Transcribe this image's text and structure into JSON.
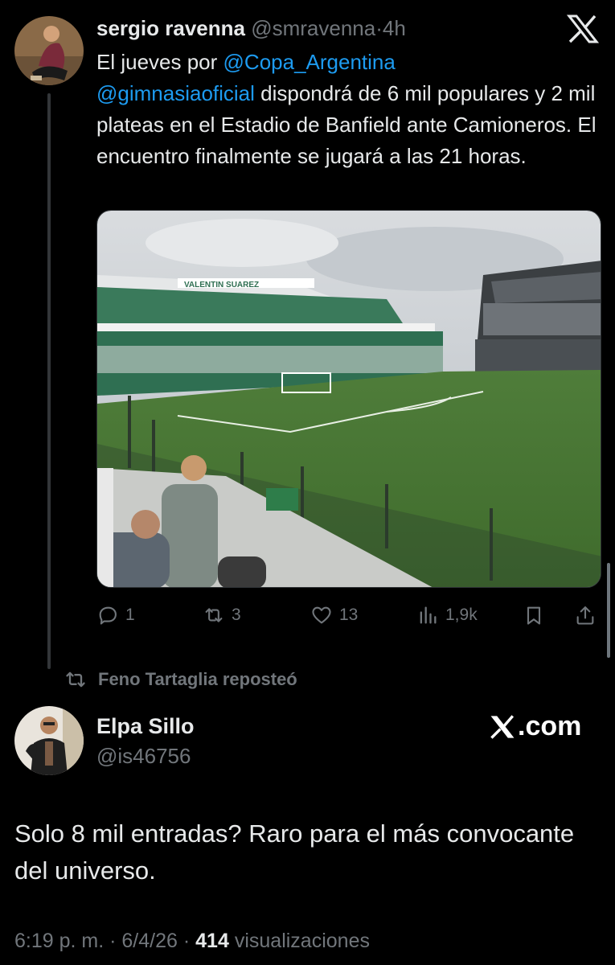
{
  "tweet": {
    "author_name": "sergio ravenna",
    "author_handle": "@smravenna",
    "separator": "·",
    "time": "4h",
    "text_part1": "El jueves por ",
    "mention1": "@Copa_Argentina",
    "mention2": "@gimnasiaoficial",
    "text_part2": " dispondrá de 6 mil populares y 2 mil plateas en el Estadio de Banfield ante Camioneros. El encuentro finalmente se jugará a las 21 horas.",
    "replies": "1",
    "reposts": "3",
    "likes": "13",
    "views": "1,9k"
  },
  "repost_label": "Feno Tartaglia reposteó",
  "reply": {
    "author_name": "Elpa Sillo",
    "author_handle": "@is46756",
    "text": "Solo 8 mil entradas? Raro para el más convocante del universo.",
    "timestamp": "6:19 p. m.",
    "date": "6/4/26",
    "views_count": "414",
    "views_label": "visualizaciones"
  },
  "watermark": {
    "text": ".com"
  },
  "stadium_banner": {
    "text": "VALENTIN SUAREZ"
  },
  "colors": {
    "background": "#000000",
    "link": "#1d9bf0",
    "muted": "#71767b",
    "text": "#e7e9ea"
  },
  "icons": [
    "x-logo-icon",
    "reply-icon",
    "repost-icon",
    "like-icon",
    "views-icon",
    "bookmark-icon",
    "share-icon"
  ]
}
